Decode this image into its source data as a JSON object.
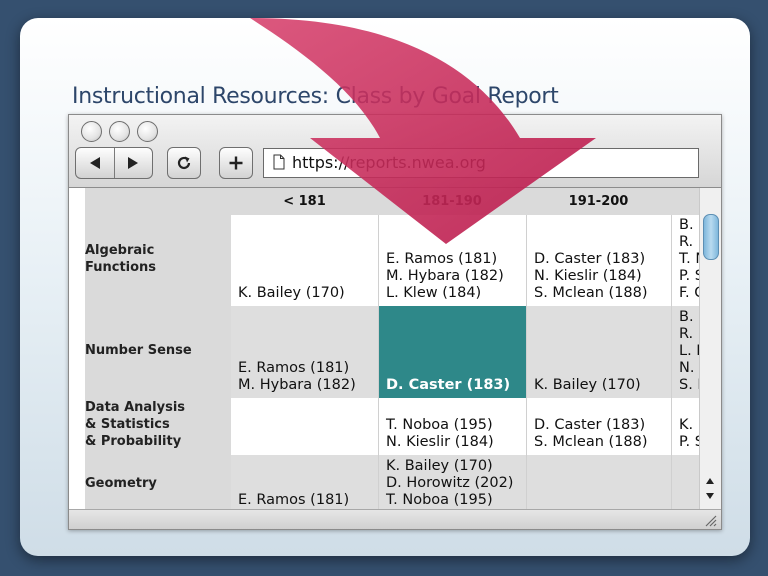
{
  "slide": {
    "title": "Instructional Resources: Class by Goal Report"
  },
  "browser": {
    "url": "https://reports.nwea.org",
    "icons": [
      "back-arrow-icon",
      "forward-arrow-icon",
      "reload-icon",
      "plus-icon",
      "document-icon"
    ]
  },
  "report": {
    "columns": [
      "< 181",
      "181-190",
      "191-200",
      ""
    ],
    "rows": [
      {
        "label_lines": [
          "Algebraic",
          "Functions"
        ],
        "cells": [
          [
            "K. Bailey (170)"
          ],
          [
            "E. Ramos (181)",
            "M. Hybara (182)",
            "L. Klew (184)"
          ],
          [
            "D. Caster (183)",
            "N. Kieslir (184)",
            "S. Mclean (188)"
          ],
          [
            "B. I",
            "R. I",
            "T. N",
            "P. S",
            "F. C"
          ]
        ]
      },
      {
        "label_lines": [
          "Number Sense"
        ],
        "cells": [
          [
            "E. Ramos (181)",
            "M. Hybara (182)"
          ],
          [
            "D. Caster (183)"
          ],
          [
            "K. Bailey (170)"
          ],
          [
            "B. I",
            "R. I",
            "L. K",
            "N.",
            "S. I"
          ]
        ]
      },
      {
        "label_lines": [
          "Data Analysis",
          "& Statistics",
          "& Probability"
        ],
        "cells": [
          [],
          [
            "T. Noboa (195)",
            "N. Kieslir (184)"
          ],
          [
            "D. Caster (183)",
            "S. Mclean (188)"
          ],
          [
            "K.",
            "P. S"
          ]
        ]
      },
      {
        "label_lines": [
          "Geometry"
        ],
        "cells": [
          [
            "E. Ramos (181)"
          ],
          [
            "K. Bailey (170)",
            "D. Horowitz (202)",
            "T. Noboa (195)"
          ],
          [],
          []
        ]
      }
    ]
  },
  "colors": {
    "background": "#35506f",
    "title": "#2d466a",
    "arrow": "#c62a5c",
    "highlight_cell": "#2e8889",
    "row_grey": "#dedede",
    "label_col": "#dadada"
  }
}
